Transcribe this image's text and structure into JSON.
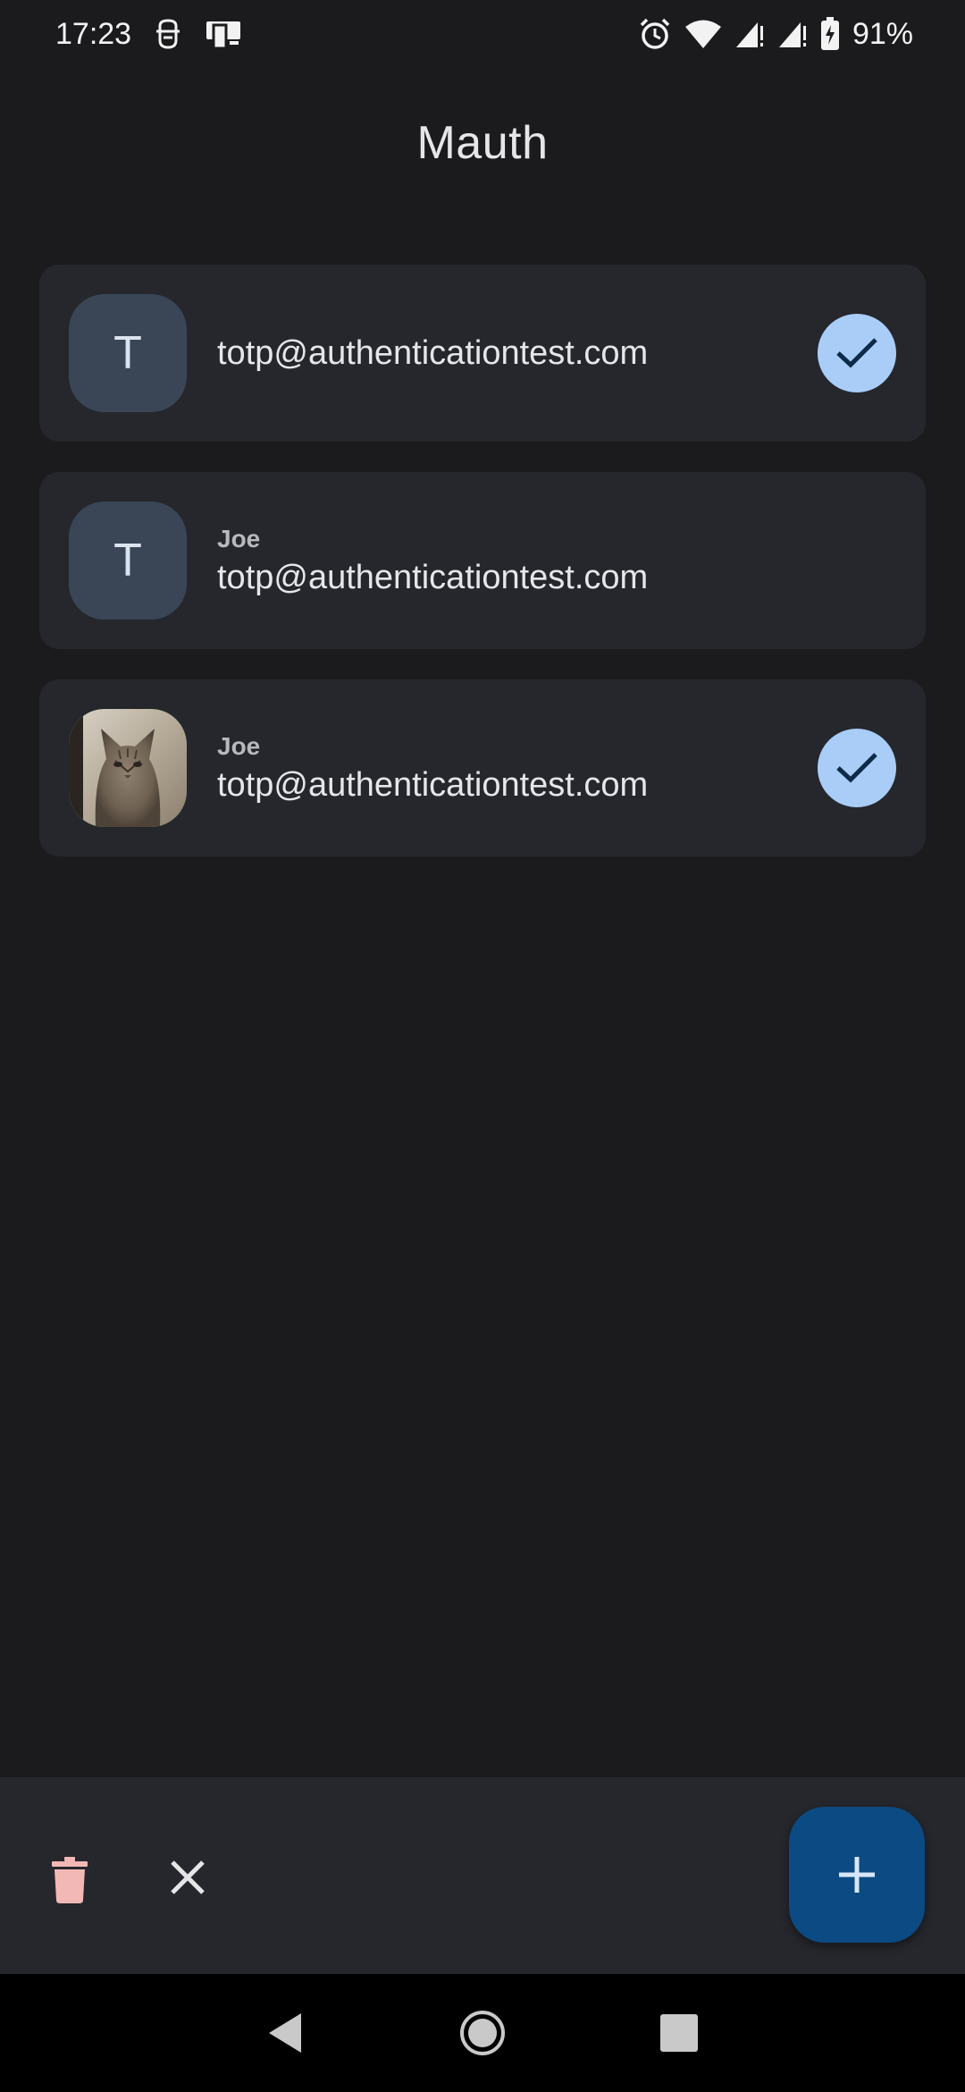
{
  "status_bar": {
    "time": "17:23",
    "battery": "91%",
    "left_icons": [
      "face-unlock-icon",
      "screen-cast-icon"
    ],
    "right_icons": [
      "alarm-icon",
      "wifi-icon",
      "signal-icon",
      "signal-icon",
      "battery-charging-icon"
    ]
  },
  "app": {
    "title": "Mauth"
  },
  "accounts": [
    {
      "avatar_letter": "T",
      "issuer": "",
      "email": "totp@authenticationtest.com",
      "selected": true
    },
    {
      "avatar_letter": "T",
      "issuer": "Joe",
      "email": "totp@authenticationtest.com",
      "selected": false
    },
    {
      "avatar_letter": "",
      "avatar_image": "cat-photo",
      "issuer": "Joe",
      "email": "totp@authenticationtest.com",
      "selected": true
    }
  ],
  "action_bar": {
    "icons": [
      "delete-icon",
      "close-icon",
      "add-icon"
    ]
  },
  "colors": {
    "background": "#1b1b1d",
    "card": "#25272c",
    "avatar": "#3a4656",
    "check_badge": "#a9cdf7",
    "fab": "#0b4a82",
    "delete": "#f2b8b5"
  }
}
